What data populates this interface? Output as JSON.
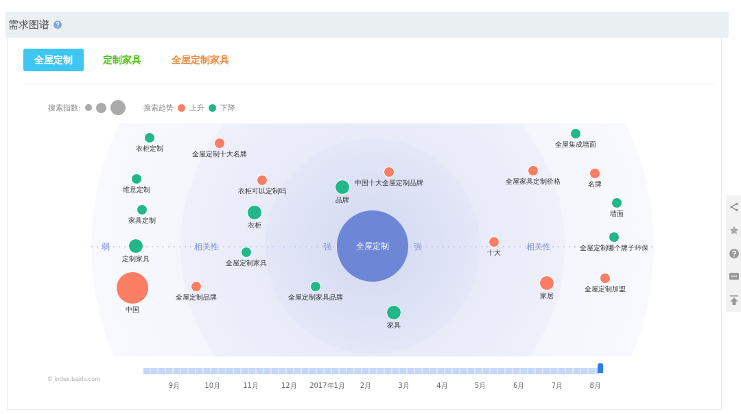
{
  "header": {
    "title": "需求图谱"
  },
  "tabs": [
    {
      "label": "全屋定制",
      "selected": true,
      "color": "#3ec6f5"
    },
    {
      "label": "定制家具",
      "selected": false,
      "color": "#52c41a"
    },
    {
      "label": "全屋定制家具",
      "selected": false,
      "color": "#f08a3c"
    }
  ],
  "legend": {
    "index_label": "搜索指数:",
    "trend_label": "搜索趋势",
    "up_label": "上升",
    "down_label": "下降"
  },
  "graph": {
    "center": "全屋定制",
    "axis_labels": [
      "弱",
      "相关性",
      "强",
      "强",
      "相关性"
    ],
    "nodes": [
      {
        "label": "衣柜定制",
        "color": "#22b78a",
        "kind": "small"
      },
      {
        "label": "全屋定制十大名牌",
        "color": "#fa7e63",
        "kind": "small"
      },
      {
        "label": "维意定制",
        "color": "#22b78a",
        "kind": "small"
      },
      {
        "label": "衣柜可以定制吗",
        "color": "#fa7e63",
        "kind": "small"
      },
      {
        "label": "中国十大全屋定制品牌",
        "color": "#fa7e63",
        "kind": "small"
      },
      {
        "label": "品牌",
        "color": "#22b78a",
        "kind": "medium"
      },
      {
        "label": "家具定制",
        "color": "#22b78a",
        "kind": "small"
      },
      {
        "label": "衣柜",
        "color": "#22b78a",
        "kind": "medium"
      },
      {
        "label": "定制家具",
        "color": "#22b78a",
        "kind": "medium"
      },
      {
        "label": "全屋定制家具",
        "color": "#22b78a",
        "kind": "small"
      },
      {
        "label": "中国",
        "color": "#fa7e63",
        "kind": "xlarge"
      },
      {
        "label": "全屋定制品牌",
        "color": "#fa7e63",
        "kind": "small"
      },
      {
        "label": "全屋定制家具品牌",
        "color": "#22b78a",
        "kind": "small"
      },
      {
        "label": "家具",
        "color": "#22b78a",
        "kind": "medium"
      },
      {
        "label": "全屋集成墙面",
        "color": "#22b78a",
        "kind": "small"
      },
      {
        "label": "全屋家具定制价格",
        "color": "#fa7e63",
        "kind": "small"
      },
      {
        "label": "名牌",
        "color": "#fa7e63",
        "kind": "small"
      },
      {
        "label": "墙面",
        "color": "#22b78a",
        "kind": "small"
      },
      {
        "label": "十大",
        "color": "#fa7e63",
        "kind": "small"
      },
      {
        "label": "全屋定制哪个牌子环保",
        "color": "#22b78a",
        "kind": "small"
      },
      {
        "label": "家居",
        "color": "#fa7e63",
        "kind": "medium"
      },
      {
        "label": "全屋定制加盟",
        "color": "#fa7e63",
        "kind": "small"
      }
    ]
  },
  "timeline": {
    "level": 1,
    "months": [
      "9月",
      "10月",
      "11月",
      "12月",
      "2017年1月",
      "2月",
      "3月",
      "4月",
      "5月",
      "6月",
      "7月",
      "8月"
    ]
  },
  "copyright": "© index.baidu.com"
}
